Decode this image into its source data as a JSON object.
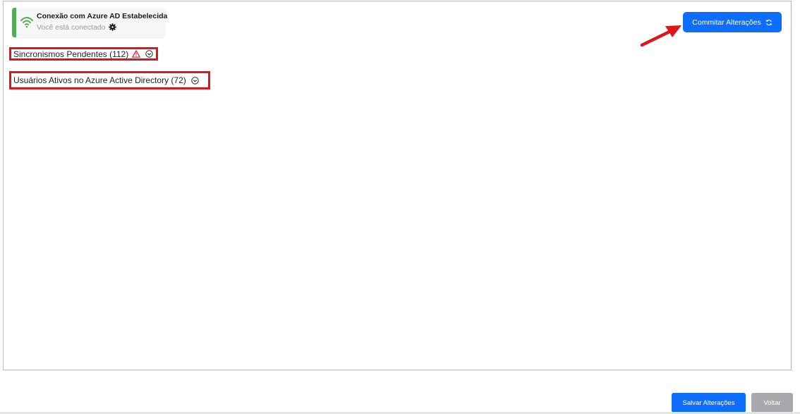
{
  "connection": {
    "title": "Conexão com Azure AD Estabelecida",
    "subtitle": "Você está conectado",
    "status_color": "#4caf50"
  },
  "toolbar": {
    "commit_label": "Commitar Alterações"
  },
  "sections": [
    {
      "label": "Sincronismos Pendentes (112)",
      "has_warning": true
    },
    {
      "label": "Usuários Ativos no Azure Active Directory (72)",
      "has_warning": false
    }
  ],
  "footer": {
    "save_label": "Salvar Alterações",
    "back_label": "Voltar"
  },
  "colors": {
    "primary": "#0d6efd",
    "secondary": "#a8a8ad",
    "highlight": "#e0141b"
  },
  "icons": [
    "wifi-icon",
    "gear-icon",
    "sync-icon",
    "warning-icon",
    "chevron-circle-icon",
    "annotation-arrow"
  ]
}
